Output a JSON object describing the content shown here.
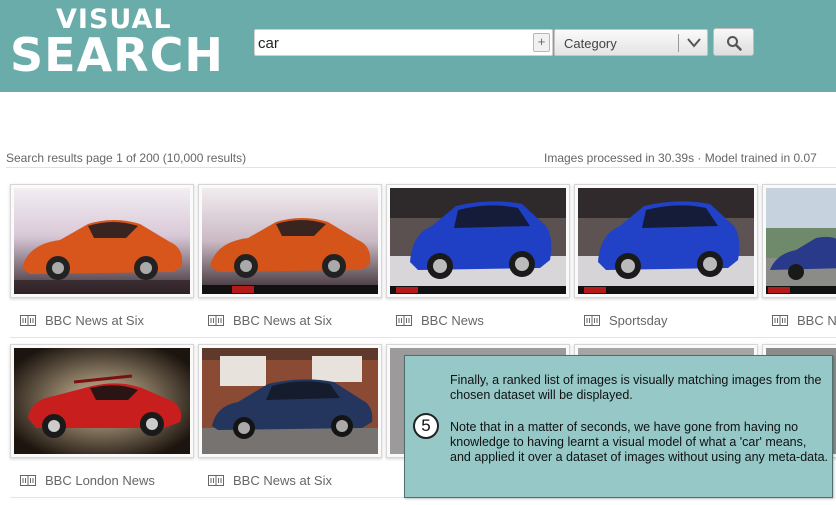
{
  "header": {
    "logo_line1": "VISUAL",
    "logo_line2": "SEARCH",
    "search_value": "car",
    "plus_label": "+",
    "category_label": "Category",
    "category_icon": "chevron-down-icon",
    "search_icon": "search-icon",
    "colors": {
      "header_bg": "#6aacaa"
    }
  },
  "status": {
    "left": "Search results page 1 of 200 (10,000 results)",
    "right": "Images processed in 30.39s · Model trained in 0.07"
  },
  "results": [
    {
      "label": "BBC News at Six",
      "image": "orange sports car on black reflective floor"
    },
    {
      "label": "BBC News at Six",
      "image": "orange sports car with BBC News ticker"
    },
    {
      "label": "BBC News",
      "image": "blue hatchback at motor show"
    },
    {
      "label": "Sportsday",
      "image": "blue hatchback at motor show with BBC News ticker"
    },
    {
      "label": "BBC N",
      "image": "blue car outdoors (partially visible)"
    },
    {
      "label": "BBC London News",
      "image": "red toy sports car"
    },
    {
      "label": "BBC News at Six",
      "image": "dark blue saloon parked by brick house"
    }
  ],
  "book_icon": "book-icon",
  "overlay": {
    "step": "5",
    "paragraph1": "Finally, a ranked list of images is visually matching images from the chosen dataset will be displayed.",
    "paragraph2": "Note that in a matter of seconds, we have gone from having no knowledge to having learnt a visual model of what a 'car' means, and applied it over a dataset of images without using any meta-data."
  }
}
